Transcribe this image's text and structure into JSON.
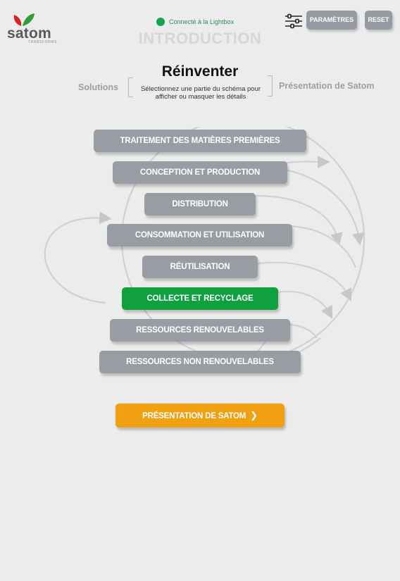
{
  "brand": {
    "name": "satom",
    "tagline": "TRANSFORMS",
    "colors": {
      "leaf_red": "#d2232a",
      "leaf_green": "#2e9e3c",
      "text": "#555a5e"
    }
  },
  "status": {
    "text": "Connecté à la Lightbox",
    "color": "#16a44a"
  },
  "page_header": "INTRODUCTION",
  "controls": {
    "settings_icon": "sliders-icon",
    "params_label": "PARAMÈTRES",
    "reset_label": "RESET"
  },
  "title": "Réinventer",
  "subtitle": "Sélectionnez une partie du schéma pour afficher ou masquer les détails",
  "nav": {
    "prev": "Solutions",
    "next": "Présentation de Satom"
  },
  "steps": [
    {
      "label": "TRAITEMENT DES MATIÈRES PREMIÈRES",
      "active": false
    },
    {
      "label": "CONCEPTION ET PRODUCTION",
      "active": false
    },
    {
      "label": "DISTRIBUTION",
      "active": false
    },
    {
      "label": "CONSOMMATION ET UTILISATION",
      "active": false
    },
    {
      "label": "RÉUTILISATION",
      "active": false
    },
    {
      "label": "COLLECTE ET RECYCLAGE",
      "active": true
    },
    {
      "label": "RESSOURCES RENOUVELABLES",
      "active": false
    },
    {
      "label": "RESSOURCES NON RENOUVELABLES",
      "active": false
    }
  ],
  "cta": {
    "label": "PRÉSENTATION DE SATOM",
    "icon": "chevron-right-icon",
    "color": "#f0a010"
  },
  "accent_colors": {
    "step": "#979da2",
    "active": "#10a040"
  }
}
